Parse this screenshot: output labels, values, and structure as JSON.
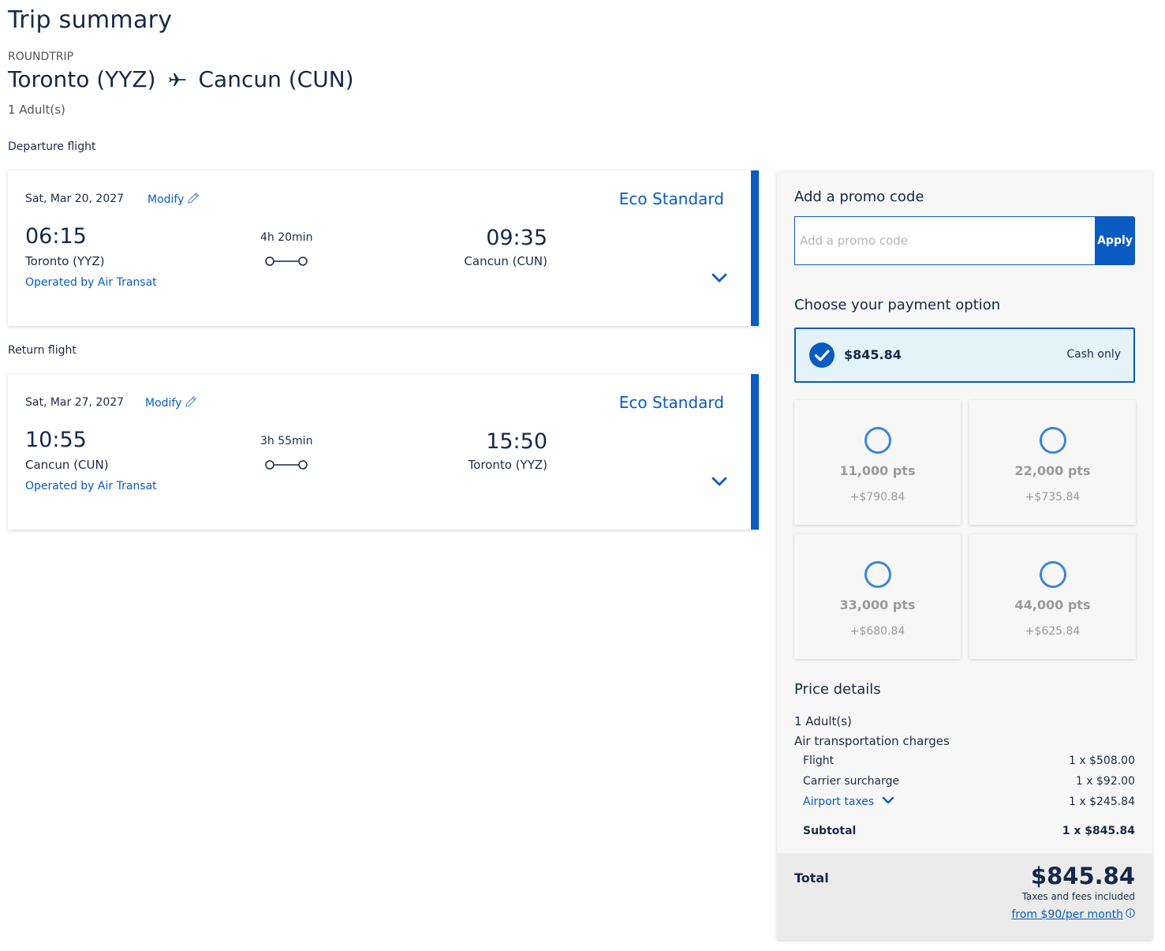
{
  "page": {
    "title": "Trip summary",
    "trip_type": "ROUNDTRIP",
    "origin": "Toronto (YYZ)",
    "destination": "Cancun (CUN)",
    "passengers": "1 Adult(s)"
  },
  "departure": {
    "section_label": "Departure flight",
    "date": "Sat, Mar 20, 2027",
    "modify_label": "Modify",
    "fare_class": "Eco Standard",
    "dep_time": "06:15",
    "dep_city": "Toronto (YYZ)",
    "duration": "4h 20min",
    "arr_time": "09:35",
    "arr_city": "Cancun (CUN)",
    "operator": "Operated by Air Transat"
  },
  "return": {
    "section_label": "Return flight",
    "date": "Sat, Mar 27, 2027",
    "modify_label": "Modify",
    "fare_class": "Eco Standard",
    "dep_time": "10:55",
    "dep_city": "Cancun (CUN)",
    "duration": "3h 55min",
    "arr_time": "15:50",
    "arr_city": "Toronto (YYZ)",
    "operator": "Operated by Air Transat"
  },
  "promo": {
    "title": "Add a promo code",
    "placeholder": "Add a promo code",
    "value": "",
    "apply_label": "Apply"
  },
  "payment": {
    "title": "Choose your payment option",
    "selected": {
      "amount": "$845.84",
      "label": "Cash only"
    },
    "options": [
      {
        "points": "11,000 pts",
        "cash": "+$790.84"
      },
      {
        "points": "22,000 pts",
        "cash": "+$735.84"
      },
      {
        "points": "33,000 pts",
        "cash": "+$680.84"
      },
      {
        "points": "44,000 pts",
        "cash": "+$625.84"
      }
    ]
  },
  "price": {
    "title": "Price details",
    "passengers": "1 Adult(s)",
    "charges_label": "Air transportation charges",
    "rows": [
      {
        "label": "Flight",
        "value": "1 x $508.00"
      },
      {
        "label": "Carrier surcharge",
        "value": "1 x $92.00"
      },
      {
        "label": "Airport taxes",
        "value": "1 x $245.84"
      }
    ],
    "subtotal_label": "Subtotal",
    "subtotal_value": "1 x $845.84",
    "total_label": "Total",
    "total_value": "$845.84",
    "total_note": "Taxes and fees included",
    "monthly_link": "from $90/per month"
  },
  "colors": {
    "brand_blue": "#0a5bc2",
    "navy_text": "#13294b",
    "selected_bg": "#e3f3f9"
  },
  "icons": [
    "airplane-icon",
    "pencil-icon",
    "chevron-down-icon",
    "check-circle-icon",
    "radio-icon",
    "info-icon"
  ]
}
